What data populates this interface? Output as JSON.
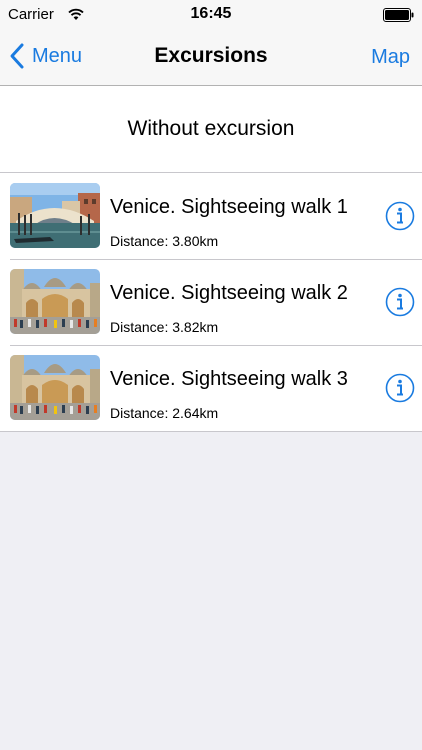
{
  "status_bar": {
    "carrier": "Carrier",
    "time": "16:45"
  },
  "nav": {
    "back_label": "Menu",
    "title": "Excursions",
    "right_label": "Map"
  },
  "no_excursion_label": "Without excursion",
  "excursions": [
    {
      "title": "Venice. Sightseeing walk 1",
      "distance": "Distance: 3.80km",
      "image": "venice-bridge-photo"
    },
    {
      "title": "Venice. Sightseeing walk 2",
      "distance": "Distance: 3.82km",
      "image": "san-marco-basilica-photo"
    },
    {
      "title": "Venice. Sightseeing walk 3",
      "distance": "Distance: 2.64km",
      "image": "san-marco-basilica-photo"
    }
  ],
  "colors": {
    "accent": "#1a7be0",
    "background": "#efeff4"
  },
  "icons": {
    "back": "chevron-left-icon",
    "info": "info-circle-icon",
    "wifi": "wifi-icon",
    "battery": "battery-icon"
  }
}
